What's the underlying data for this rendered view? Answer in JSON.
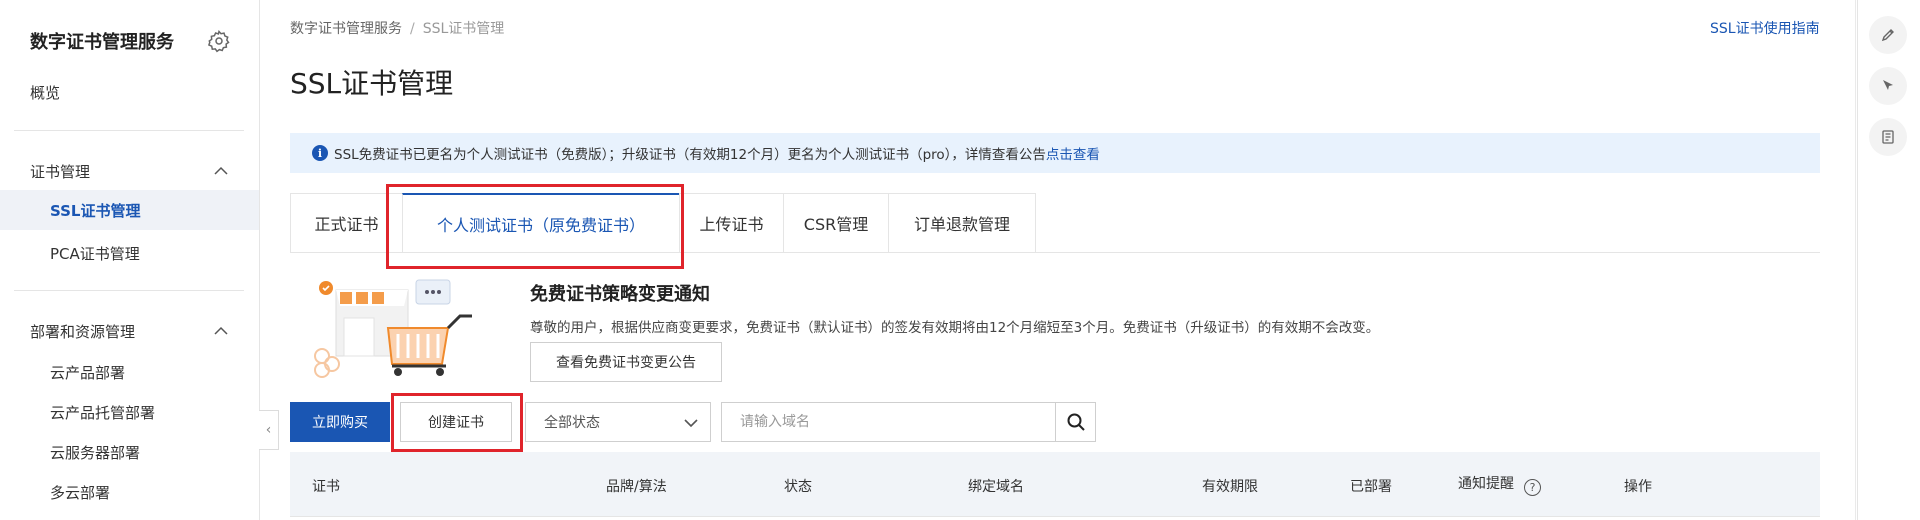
{
  "sidebar": {
    "title": "数字证书管理服务",
    "overview": "概览",
    "group_cert": "证书管理",
    "ssl": "SSL证书管理",
    "pca": "PCA证书管理",
    "group_deploy": "部署和资源管理",
    "deploy_items": [
      "云产品部署",
      "云产品托管部署",
      "云服务器部署",
      "多云部署"
    ]
  },
  "breadcrumb": {
    "root": "数字证书管理服务",
    "sep": "/",
    "current": "SSL证书管理"
  },
  "guide_link": "SSL证书使用指南",
  "page_title": "SSL证书管理",
  "notice": {
    "text": "SSL免费证书已更名为个人测试证书（免费版）；升级证书（有效期12个月）更名为个人测试证书（pro），详情查看公告",
    "link": "点击查看"
  },
  "tabs": [
    "正式证书",
    "个人测试证书（原免费证书）",
    "上传证书",
    "CSR管理",
    "订单退款管理"
  ],
  "active_tab": 1,
  "banner": {
    "title": "免费证书策略变更通知",
    "desc": "尊敬的用户，根据供应商变更要求，免费证书（默认证书）的签发有效期将由12个月缩短至3个月。免费证书（升级证书）的有效期不会改变。",
    "button": "查看免费证书变更公告"
  },
  "toolbar": {
    "buy": "立即购买",
    "create": "创建证书",
    "status_value": "全部状态",
    "search_placeholder": "请输入域名"
  },
  "table": {
    "columns": [
      "证书",
      "品牌/算法",
      "状态",
      "绑定域名",
      "有效期限",
      "已部署",
      "通知提醒",
      "操作"
    ]
  },
  "colors": {
    "accent": "#1a56b3",
    "highlight": "#e0242b",
    "notice_bg": "#e8f2fd"
  },
  "icons": {
    "gear": "gear-icon",
    "search": "search-icon",
    "info": "info-icon",
    "help": "help-icon"
  }
}
